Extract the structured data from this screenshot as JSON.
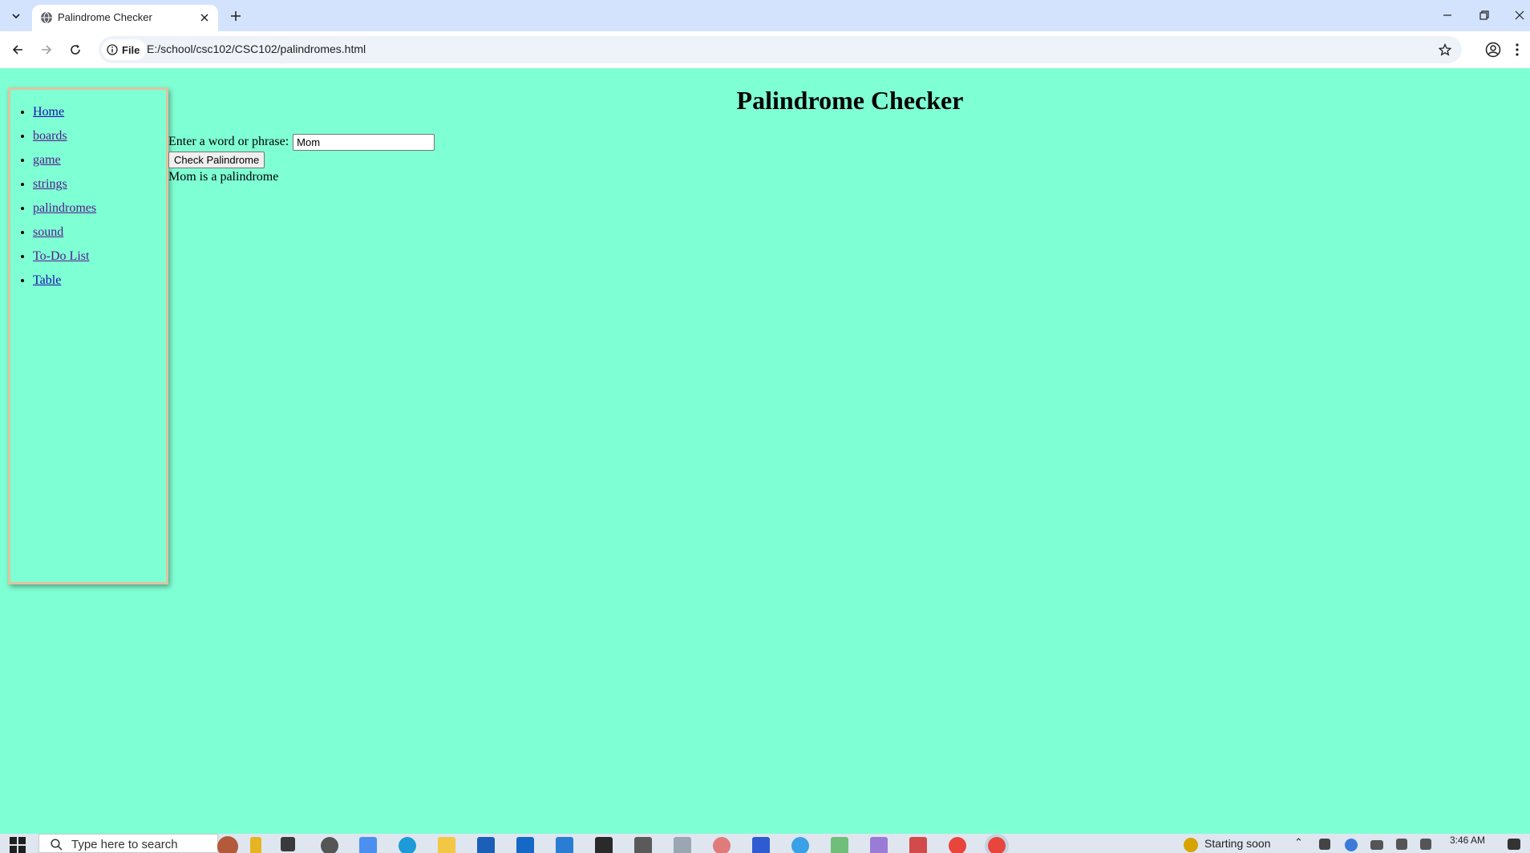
{
  "browser": {
    "tab": {
      "title": "Palindrome Checker"
    },
    "address": {
      "chip_label": "File",
      "url": "E:/school/csc102/CSC102/palindromes.html"
    }
  },
  "sidebar": {
    "items": [
      {
        "label": "Home"
      },
      {
        "label": "boards"
      },
      {
        "label": "game"
      },
      {
        "label": "strings"
      },
      {
        "label": "palindromes"
      },
      {
        "label": "sound"
      },
      {
        "label": "To-Do List"
      },
      {
        "label": "Table"
      }
    ]
  },
  "main": {
    "title": "Palindrome Checker",
    "form": {
      "label": "Enter a word or phrase:",
      "input_value": "Mom",
      "button_label": "Check Palindrome"
    },
    "result": "Mom is a palindrome"
  },
  "taskbar": {
    "search_placeholder": "Type here to search",
    "weather_text": "Starting soon",
    "clock": "3:46 AM"
  },
  "colors": {
    "page_background": "#7fffd4",
    "sidebar_border": "#e0c4a0",
    "link": "#1a0dab",
    "visited_link": "#551a8b"
  }
}
